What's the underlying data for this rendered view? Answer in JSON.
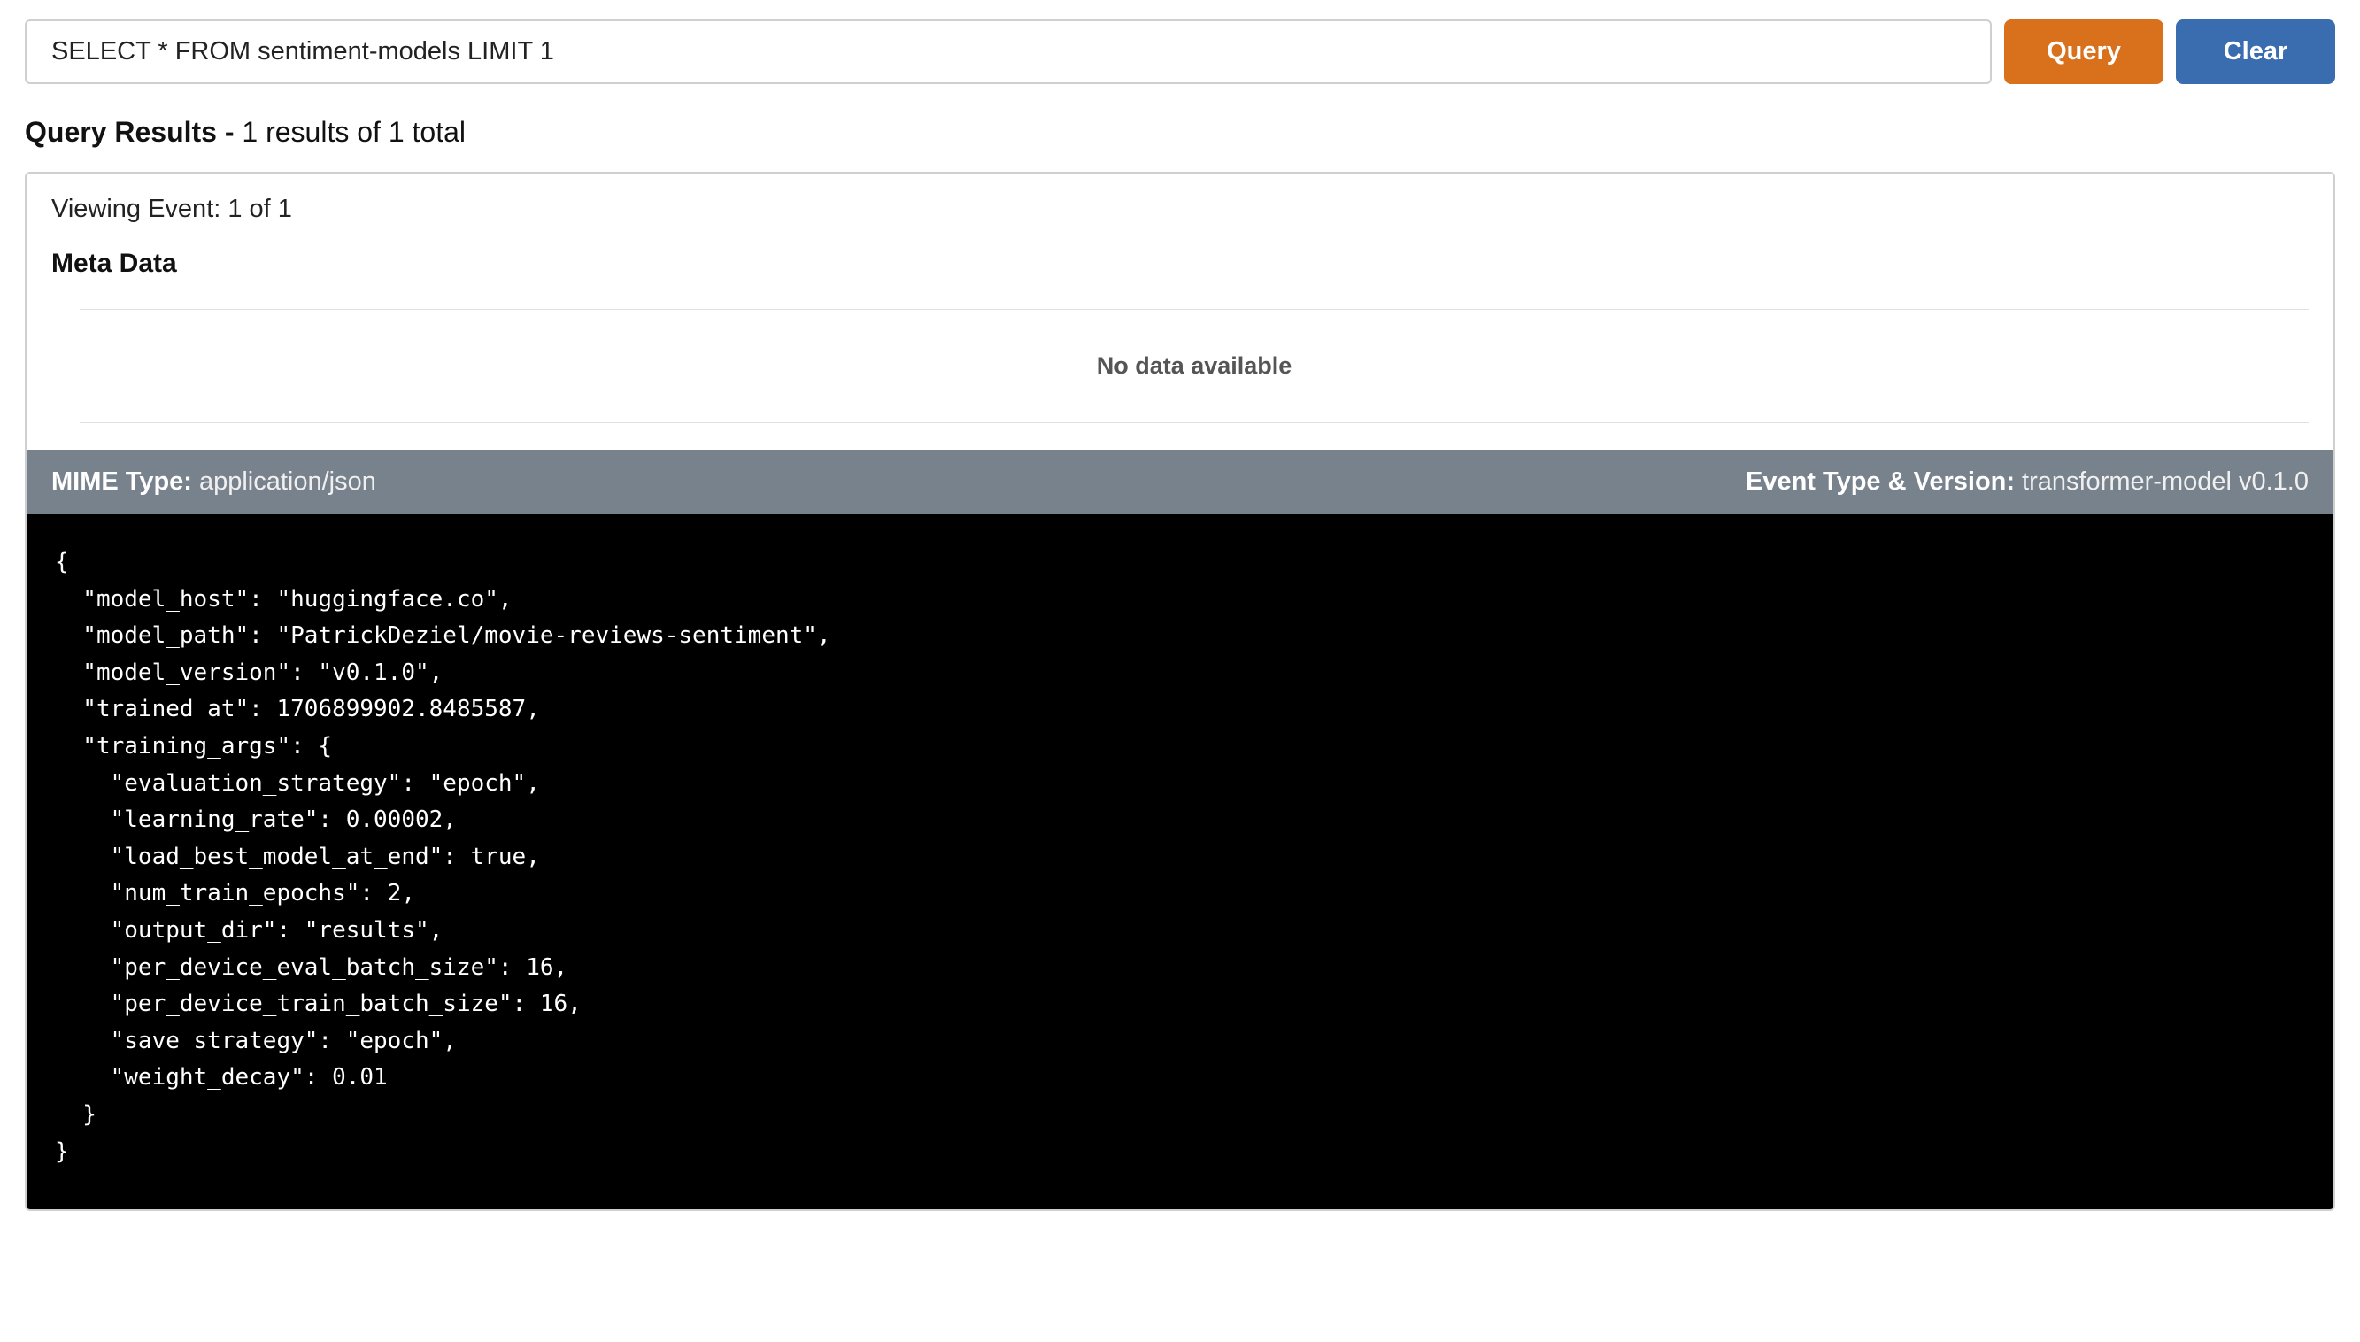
{
  "query": {
    "value": "SELECT * FROM sentiment-models LIMIT 1",
    "query_button_label": "Query",
    "clear_button_label": "Clear"
  },
  "results": {
    "header_bold": "Query Results -",
    "header_rest": " 1 results of 1 total",
    "viewing_text": "Viewing Event: 1 of 1",
    "meta_heading": "Meta Data",
    "no_data_text": "No data available"
  },
  "info_bar": {
    "mime_label": "MIME Type:",
    "mime_value": "application/json",
    "event_label": "Event Type & Version:",
    "event_value": "transformer-model v0.1.0"
  },
  "json_payload": "{\n  \"model_host\": \"huggingface.co\",\n  \"model_path\": \"PatrickDeziel/movie-reviews-sentiment\",\n  \"model_version\": \"v0.1.0\",\n  \"trained_at\": 1706899902.8485587,\n  \"training_args\": {\n    \"evaluation_strategy\": \"epoch\",\n    \"learning_rate\": 0.00002,\n    \"load_best_model_at_end\": true,\n    \"num_train_epochs\": 2,\n    \"output_dir\": \"results\",\n    \"per_device_eval_batch_size\": 16,\n    \"per_device_train_batch_size\": 16,\n    \"save_strategy\": \"epoch\",\n    \"weight_decay\": 0.01\n  }\n}"
}
